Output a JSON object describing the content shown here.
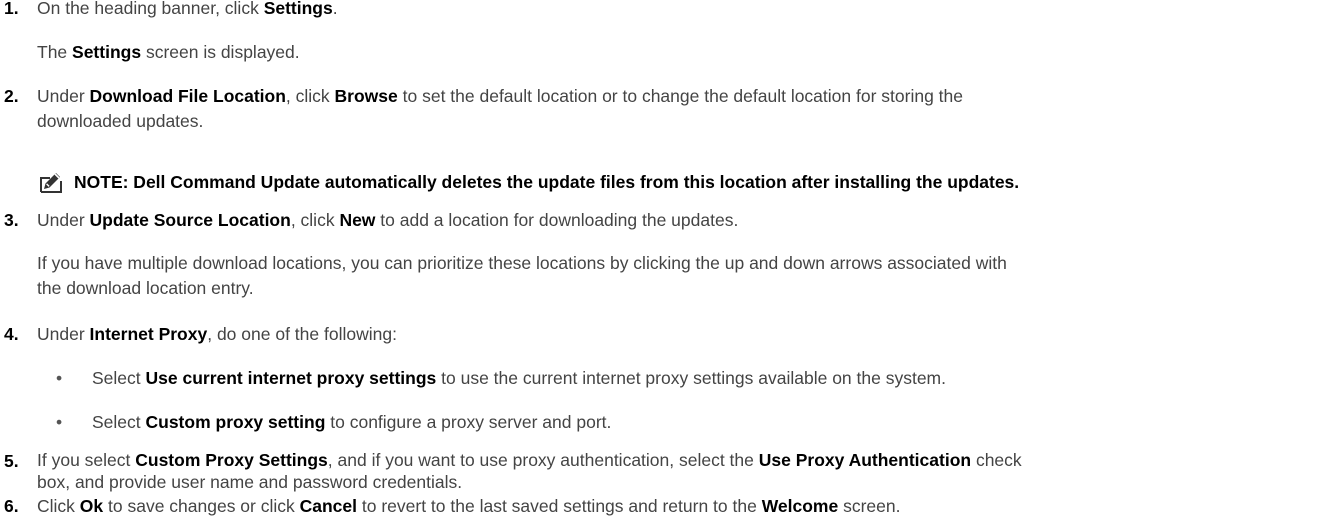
{
  "steps": [
    {
      "number": "1.",
      "parts": [
        {
          "t": "On the heading banner, click ",
          "b": false
        },
        {
          "t": "Settings",
          "b": true
        },
        {
          "t": ".",
          "b": false
        }
      ],
      "followup": [
        {
          "t": "The ",
          "b": false
        },
        {
          "t": "Settings",
          "b": true
        },
        {
          "t": " screen is displayed.",
          "b": false
        }
      ]
    },
    {
      "number": "2.",
      "parts": [
        {
          "t": "Under ",
          "b": false
        },
        {
          "t": "Download File Location",
          "b": true
        },
        {
          "t": ", click ",
          "b": false
        },
        {
          "t": "Browse",
          "b": true
        },
        {
          "t": " to set the default location or to change the default location for storing the",
          "b": false
        }
      ],
      "line2": "downloaded updates."
    },
    {
      "number": "3.",
      "parts": [
        {
          "t": "Under ",
          "b": false
        },
        {
          "t": "Update Source Location",
          "b": true
        },
        {
          "t": ", click ",
          "b": false
        },
        {
          "t": "New",
          "b": true
        },
        {
          "t": " to add a location for downloading the updates.",
          "b": false
        }
      ],
      "followup_line1": "If you have multiple download locations, you can prioritize these locations by clicking the up and down arrows associated with",
      "followup_line2": "the download location entry."
    },
    {
      "number": "4.",
      "parts": [
        {
          "t": "Under ",
          "b": false
        },
        {
          "t": "Internet Proxy",
          "b": true
        },
        {
          "t": ", do one of the following:",
          "b": false
        }
      ],
      "bullets": [
        [
          {
            "t": "Select ",
            "b": false
          },
          {
            "t": "Use current internet proxy settings",
            "b": true
          },
          {
            "t": " to use the current internet proxy settings available on the system.",
            "b": false
          }
        ],
        [
          {
            "t": "Select ",
            "b": false
          },
          {
            "t": "Custom proxy setting",
            "b": true
          },
          {
            "t": " to configure a proxy server and port.",
            "b": false
          }
        ]
      ]
    },
    {
      "number": "5.",
      "parts": [
        {
          "t": "If you select ",
          "b": false
        },
        {
          "t": "Custom Proxy Settings",
          "b": true
        },
        {
          "t": ", and if you want to use proxy authentication, select the ",
          "b": false
        },
        {
          "t": "Use Proxy Authentication",
          "b": true
        },
        {
          "t": " check",
          "b": false
        }
      ],
      "line2": "box, and provide user name and password credentials."
    },
    {
      "number": "6.",
      "parts": [
        {
          "t": "Click ",
          "b": false
        },
        {
          "t": "Ok",
          "b": true
        },
        {
          "t": " to save changes or click ",
          "b": false
        },
        {
          "t": "Cancel",
          "b": true
        },
        {
          "t": " to revert to the last saved settings and return to the ",
          "b": false
        },
        {
          "t": "Welcome",
          "b": true
        },
        {
          "t": " screen.",
          "b": false
        }
      ]
    }
  ],
  "note": {
    "icon": "pencil-note-icon",
    "text": "NOTE: Dell Command Update automatically deletes the update files from this location after installing the updates."
  },
  "bullet_glyph": "•"
}
